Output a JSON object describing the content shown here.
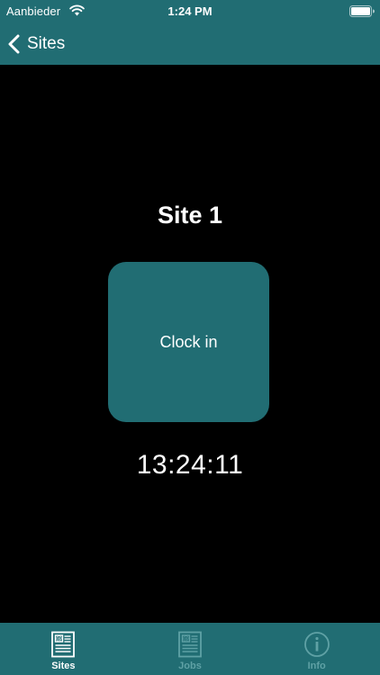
{
  "status_bar": {
    "carrier": "Aanbieder",
    "time": "1:24 PM"
  },
  "nav": {
    "back_label": "Sites"
  },
  "main": {
    "site_title": "Site 1",
    "clock_in_label": "Clock in",
    "current_time": "13:24:11"
  },
  "tab_bar": {
    "tabs": [
      {
        "label": "Sites",
        "icon": "newspaper-icon",
        "active": true
      },
      {
        "label": "Jobs",
        "icon": "newspaper-icon",
        "active": false
      },
      {
        "label": "Info",
        "icon": "info-circle-icon",
        "active": false
      }
    ]
  },
  "colors": {
    "accent": "#216d73",
    "background": "#000000",
    "inactive_tab": "#5fa1a5",
    "text": "#ffffff"
  }
}
